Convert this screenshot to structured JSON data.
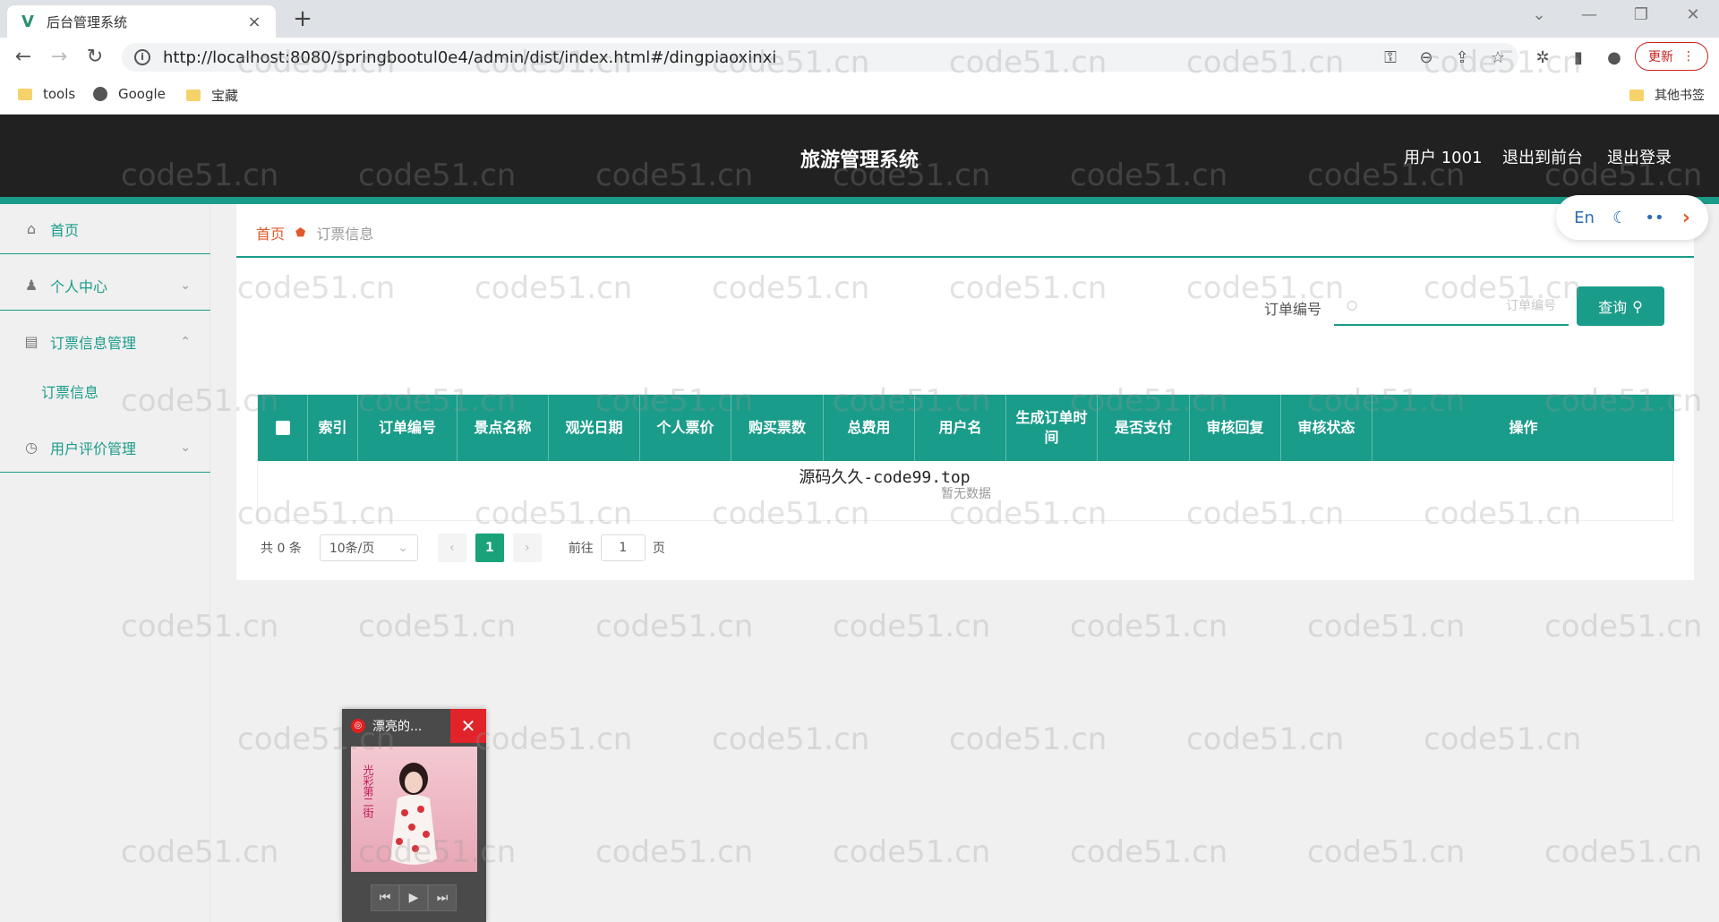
{
  "browser": {
    "tab_title": "后台管理系统",
    "tab_close": "×",
    "new_tab": "+",
    "url": "http://localhost:8080/springbootul0e4/admin/dist/index.html#/dingpiaoxinxi",
    "update_label": "更新",
    "bookmarks": [
      "tools",
      "Google",
      "宝藏"
    ],
    "other_bookmarks": "其他书签"
  },
  "header": {
    "title": "旅游管理系统",
    "user": "用户 1001",
    "back_to_front": "退出到前台",
    "logout": "退出登录"
  },
  "sidebar": {
    "items": [
      {
        "label": "首页"
      },
      {
        "label": "个人中心"
      },
      {
        "label": "订票信息管理"
      },
      {
        "label": "订票信息"
      },
      {
        "label": "用户评价管理"
      }
    ]
  },
  "breadcrumb": {
    "home": "首页",
    "current": "订票信息"
  },
  "lang_pill": {
    "lang": "En"
  },
  "search": {
    "label": "订单编号",
    "placeholder": "订单编号",
    "button": "查询"
  },
  "table": {
    "columns": [
      "索引",
      "订单编号",
      "景点名称",
      "观光日期",
      "个人票价",
      "购买票数",
      "总费用",
      "用户名",
      "生成订单时间",
      "是否支付",
      "审核回复",
      "审核状态",
      "操作"
    ],
    "overlay_text": "源码久久-code99.top",
    "empty_text": "暂无数据"
  },
  "pagination": {
    "total": "共 0 条",
    "page_size": "10条/页",
    "current_page": "1",
    "goto_label": "前往",
    "goto_value": "1",
    "page_suffix": "页"
  },
  "player": {
    "title": "漂亮的...",
    "cover_text": "光彩第二街"
  },
  "watermark": "code51.cn",
  "colors": {
    "accent": "#1a9c8a",
    "header_bg": "#212121",
    "breadcrumb_home": "#e05a2b",
    "pager_active": "#1aa37a"
  }
}
